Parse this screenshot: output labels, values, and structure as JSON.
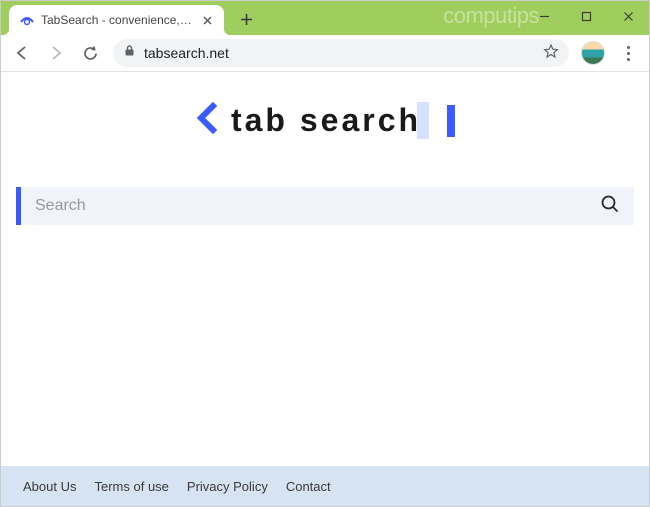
{
  "window": {
    "watermark": "computips"
  },
  "tab": {
    "title": "TabSearch - convenience, accura"
  },
  "address": {
    "url": "tabsearch.net"
  },
  "logo": {
    "text": "tab search"
  },
  "search": {
    "placeholder": "Search"
  },
  "footer": {
    "links": [
      "About Us",
      "Terms of use",
      "Privacy Policy",
      "Contact"
    ]
  }
}
